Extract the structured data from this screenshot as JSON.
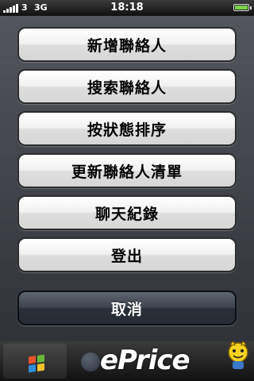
{
  "status_bar": {
    "carrier": "3",
    "network": "3G",
    "time": "18:18"
  },
  "action_sheet": {
    "buttons": [
      {
        "label": "新增聯絡人"
      },
      {
        "label": "搜索聯絡人"
      },
      {
        "label": "按狀態排序"
      },
      {
        "label": "更新聯絡人清單"
      },
      {
        "label": "聊天紀錄"
      },
      {
        "label": "登出"
      }
    ],
    "cancel_label": "取消"
  },
  "watermark": {
    "text": "ePrice"
  },
  "tab_bar": {
    "icons": [
      "windows-logo-icon",
      "contact-icon"
    ]
  }
}
